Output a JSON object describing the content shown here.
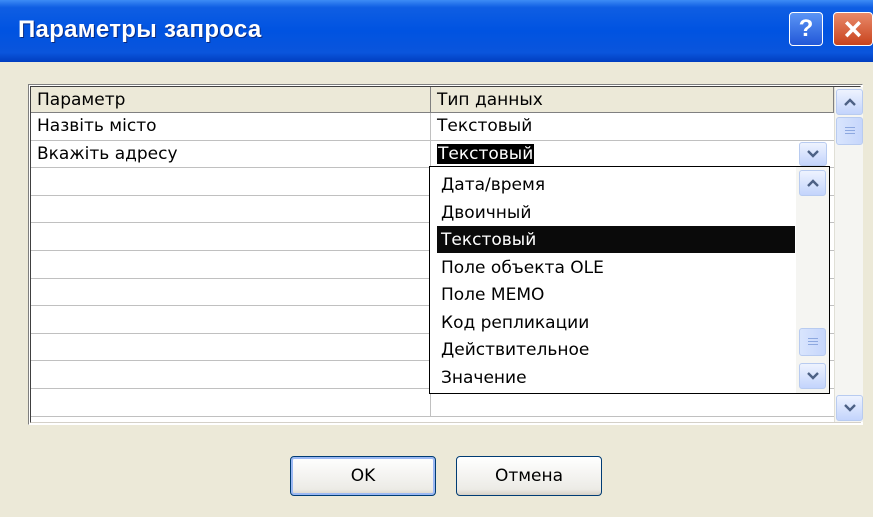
{
  "window": {
    "title": "Параметры запроса",
    "help_glyph": "?",
    "close_glyph": "×"
  },
  "grid": {
    "columns": [
      "Параметр",
      "Тип данных"
    ],
    "rows": [
      {
        "param": "Назвіть місто",
        "type": "Текстовый"
      },
      {
        "param": "Вкажіть адресу",
        "type": "Текстовый"
      }
    ]
  },
  "dropdown": {
    "selected": "Текстовый",
    "options": [
      "Дата/время",
      "Двоичный",
      "Текстовый",
      "Поле объекта OLE",
      "Поле MEMO",
      "Код репликации",
      "Действительное",
      "Значение"
    ]
  },
  "buttons": {
    "ok": "OK",
    "cancel": "Отмена"
  },
  "colors": {
    "titlebar": "#0053e1",
    "dialog_bg": "#ece9d8",
    "selection": "#000000",
    "close_button": "#c8431d"
  },
  "icons": [
    "help-icon",
    "close-icon",
    "chevron-up-icon",
    "chevron-down-icon",
    "scroll-thumb-grip-icon"
  ]
}
